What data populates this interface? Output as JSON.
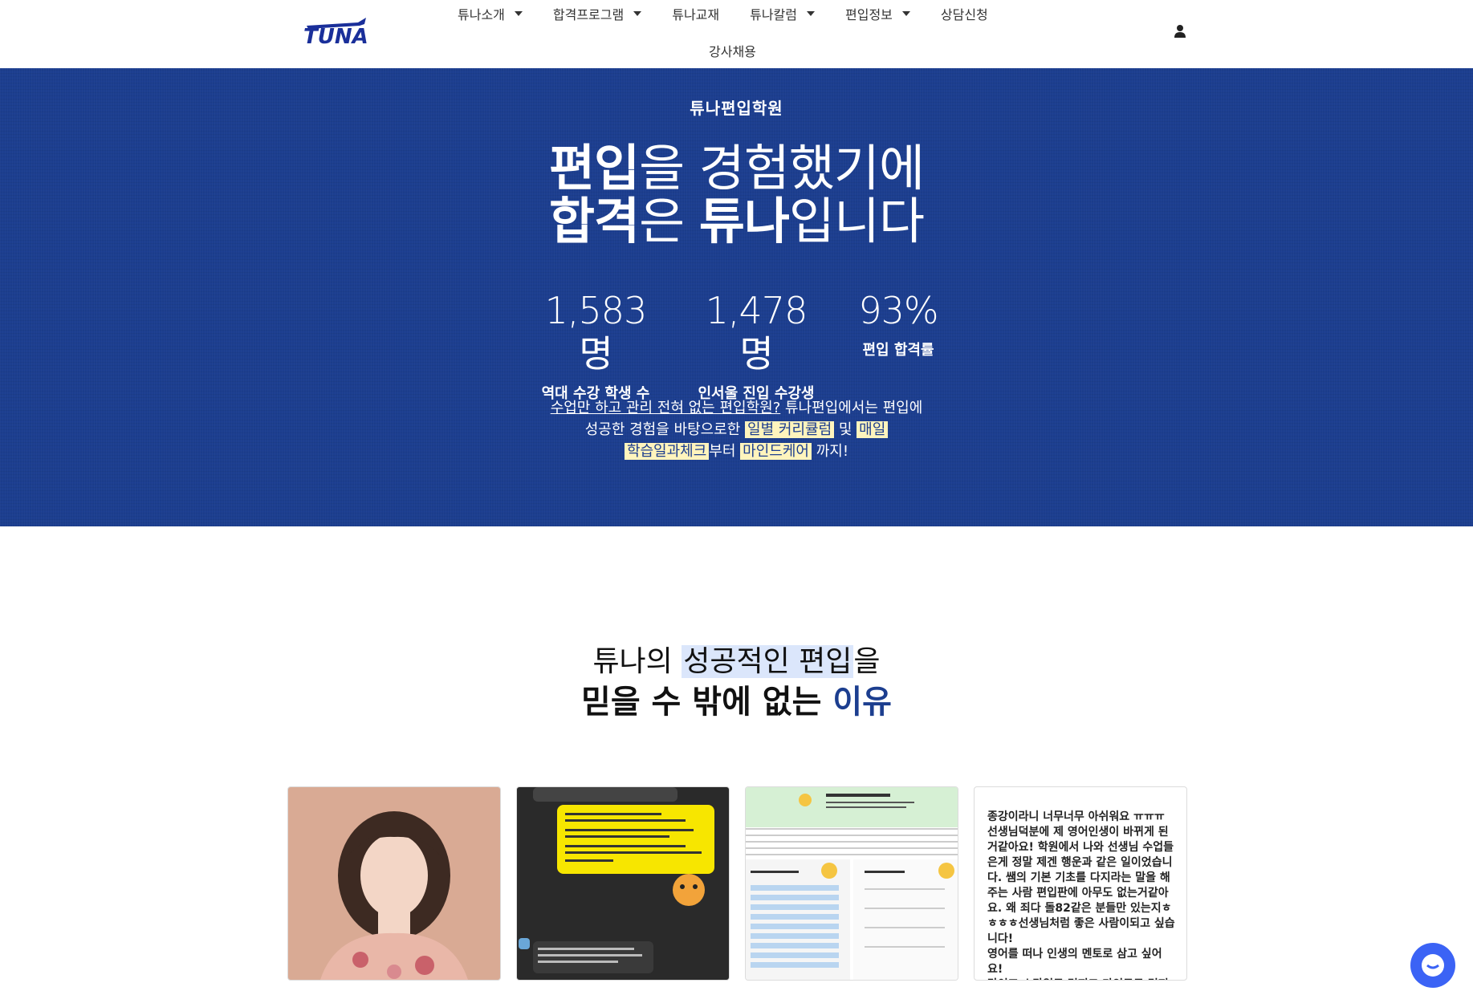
{
  "header": {
    "logo_text": "TUNA",
    "nav": [
      {
        "label": "튜나소개",
        "has_dropdown": true
      },
      {
        "label": "합격프로그램",
        "has_dropdown": true
      },
      {
        "label": "튜나교재",
        "has_dropdown": false
      },
      {
        "label": "튜나칼럼",
        "has_dropdown": true
      },
      {
        "label": "편입정보",
        "has_dropdown": true
      },
      {
        "label": "상담신청",
        "has_dropdown": false
      }
    ],
    "nav_row2": "강사채용",
    "user_icon": "user-icon"
  },
  "hero": {
    "eyebrow": "튜나편입학원",
    "headline": {
      "l1_bold": "편입",
      "l1_rest": "을 경험했기에",
      "l2_bold1": "합격",
      "l2_mid": "은 ",
      "l2_bold2": "튜나",
      "l2_rest": "입니다"
    },
    "stats": [
      {
        "value": "1,583명",
        "label": "역대 수강 학생 수"
      },
      {
        "value": "1,478명",
        "label": "인서울 진입 수강생"
      },
      {
        "value": "93%",
        "label": "편입 합격률"
      }
    ],
    "desc": {
      "underlined": "수업만 하고 관리 전혀 없는 편입학원?",
      "p1": " 튜나편입에서는 편입에",
      "p2": "성공한 경험을 바탕으로한",
      "hl1": "일별 커리큘럼",
      "p3": "및",
      "hl2": "매일",
      "hl3": "학습일과체크",
      "p4": "부터",
      "hl4": "마인드케어",
      "p5": "까지!"
    },
    "colors": {
      "background": "#1c3e8f",
      "highlight": "#fff4bd"
    }
  },
  "reasons": {
    "title_p1": "튜나의 ",
    "title_hl": "성공적인 편입",
    "title_p2": "을",
    "line2_p1": "믿을 수 밖에 없는 ",
    "line2_accent": "이유",
    "review_text": "종강이라니 너무너무 아쉬워요 ㅠㅠㅠ 선생님덕분에 제 영어인생이 바뀌게 된거같아요! 학원에서 나와 선생님 수업들은게 정말 제겐 행운과 같은 일이었습니다. 쌤의 기본 기초를 다지라는 말을 해주는 사람 편입판에 아무도 없는거같아요. 왜 죄다 돌82같은 분들만 있는지ㅎㅎㅎㅎ선생님처럼 좋은 사람이되고 싶습니다!\n영어를 떠나 인생의 멘토로 삼고 싶어요!\n라이프 스타일도 멋지고 마인드도 멋져서\n너무너무 존경합니다 쌤 ❤️"
  }
}
